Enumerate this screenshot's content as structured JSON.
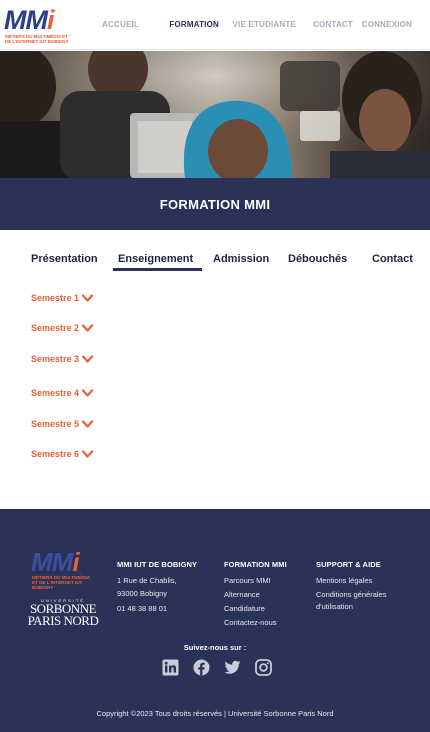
{
  "brand": {
    "logo_text": "MM",
    "logo_i": "i",
    "logo_sub": "MÉTIERS DU MULTIMÉDIA ET DE L'INTERNET IUT BOBIGNY"
  },
  "nav": {
    "items": [
      {
        "label": "ACCUEIL"
      },
      {
        "label": "FORMATION"
      },
      {
        "label": "VIE ETUDIANTE"
      },
      {
        "label": "CONTACT"
      },
      {
        "label": "CONNEXION"
      }
    ]
  },
  "page_title": "FORMATION MMI",
  "tabs": [
    {
      "label": "Présentation"
    },
    {
      "label": "Enseignement"
    },
    {
      "label": "Admission"
    },
    {
      "label": "Débouchés"
    },
    {
      "label": "Contact"
    }
  ],
  "semesters": [
    {
      "label": "Semestre 1"
    },
    {
      "label": "Semestre 2"
    },
    {
      "label": "Semestre 3"
    },
    {
      "label": "Semestre 4"
    },
    {
      "label": "Semestre 5"
    },
    {
      "label": "Semestre 6"
    }
  ],
  "footer": {
    "university_top": "UNIVERSITÉ",
    "university_line1": "SORBONNE",
    "university_line2": "PARIS NORD",
    "col1": {
      "title": "MMI IUT DE BOBIGNY",
      "address1": "1 Rue de Chablis,",
      "address2": "93000 Bobigny",
      "phone": "01 48 38 88 01"
    },
    "col2": {
      "title": "FORMATION MMI",
      "links": [
        "Parcours MMI",
        "Alternance",
        "Candidature",
        "Contactez-nous"
      ]
    },
    "col3": {
      "title": "SUPPORT & AIDE",
      "link1": "Mentions légales",
      "link2a": "Conditions générales",
      "link2b": "d'utilisation"
    },
    "follow": "Suivez-nous sur :",
    "socials": [
      "linkedin-icon",
      "facebook-icon",
      "twitter-icon",
      "instagram-icon"
    ],
    "copyright": "Copyright ©2023 Tous droits réservés | Université Sorbonne Paris Nord"
  },
  "colors": {
    "navy": "#2b3257",
    "accent": "#e8603c",
    "nav_grey": "#a8abb5"
  }
}
